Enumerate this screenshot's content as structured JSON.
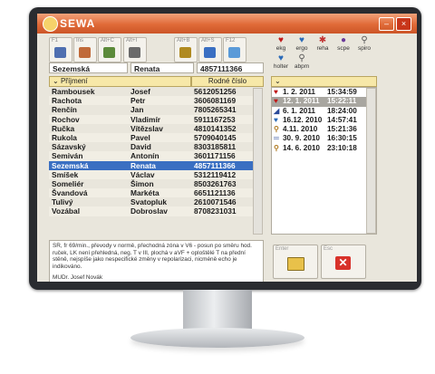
{
  "window": {
    "app_name": "SEWA",
    "minimize": "–",
    "close": "×"
  },
  "toolbar": [
    {
      "key": "F1",
      "color": "#4f6fb0"
    },
    {
      "key": "Ins",
      "color": "#c06a3a"
    },
    {
      "key": "Alt+C",
      "color": "#5b8a3a"
    },
    {
      "key": "Alt+I",
      "color": "#6a6a6a"
    },
    {
      "key": "Alt+B",
      "color": "#b08a20"
    },
    {
      "key": "Alt+S",
      "color": "#3a6fc2"
    },
    {
      "key": "F12",
      "color": "#5a9ad8"
    }
  ],
  "patient": {
    "surname": "Sezemská",
    "firstname": "Renata",
    "id": "4857111366"
  },
  "columns": {
    "surname": "Příjmení",
    "id": "Rodné číslo"
  },
  "patients": [
    [
      "Rambousek",
      "Josef",
      "5612051256"
    ],
    [
      "Rachota",
      "Petr",
      "3606081169"
    ],
    [
      "Renčín",
      "Jan",
      "7805265341"
    ],
    [
      "Rochov",
      "Vladimír",
      "5911167253"
    ],
    [
      "Ručka",
      "Vítězslav",
      "4810141352"
    ],
    [
      "Rukola",
      "Pavel",
      "5709040145"
    ],
    [
      "Sázavský",
      "David",
      "8303185811"
    ],
    [
      "Semiván",
      "Antonín",
      "3601171156"
    ],
    [
      "Sezemská",
      "Renata",
      "4857111366"
    ],
    [
      "Smíšek",
      "Václav",
      "5312119412"
    ],
    [
      "Someliér",
      "Šimon",
      "8503261763"
    ],
    [
      "Švandová",
      "Markéta",
      "6651121136"
    ],
    [
      "Tulivý",
      "Svatopluk",
      "2610071546"
    ],
    [
      "Vozábal",
      "Dobroslav",
      "8708231031"
    ]
  ],
  "note": {
    "text": "SR, fr 69/min., převody v normě, přechodná zóna v V6 - posun po směru hod. ruček, LK není přehledná, neg. T v III, plochá v aVF + oploštělé T na přední stěně, nejspíše jako nespecifické změny v repolarizaci, nicméně echo je indikováno.",
    "author": "MUDr. Josef Novák"
  },
  "exam_types": [
    {
      "label": "ekg",
      "glyph": "♥",
      "color": "#c01818"
    },
    {
      "label": "ergo",
      "glyph": "♥",
      "color": "#2a6ab8"
    },
    {
      "label": "reha",
      "glyph": "✱",
      "color": "#c03030"
    },
    {
      "label": "scpe",
      "glyph": "●",
      "color": "#6a3a9a"
    },
    {
      "label": "spiro",
      "glyph": "⚲",
      "color": "#555555"
    },
    {
      "label": "holter",
      "glyph": "♥",
      "color": "#2a6ab8"
    },
    {
      "label": "abpm",
      "glyph": "⚲",
      "color": "#555555"
    }
  ],
  "exams": [
    {
      "date": "1. 2. 2011",
      "time": "15:34:59",
      "glyph": "♥",
      "color": "#c01818"
    },
    {
      "date": "12. 1. 2011",
      "time": "15:22:11",
      "glyph": "♥",
      "color": "#c01818"
    },
    {
      "date": "6. 1. 2011",
      "time": "18:24:00",
      "glyph": "◢",
      "color": "#2a4a9a"
    },
    {
      "date": "16.12. 2010",
      "time": "14:57:41",
      "glyph": "♥",
      "color": "#2a6ab8"
    },
    {
      "date": "4.11. 2010",
      "time": "15:21:36",
      "glyph": "⚲",
      "color": "#b07a20"
    },
    {
      "date": "30. 9. 2010",
      "time": "16:30:15",
      "glyph": "═",
      "color": "#2a4a9a"
    },
    {
      "date": "14. 6. 2010",
      "time": "23:10:18",
      "glyph": "⚲",
      "color": "#b07a20"
    }
  ],
  "buttons": {
    "enter": "Enter",
    "esc": "Esc"
  }
}
